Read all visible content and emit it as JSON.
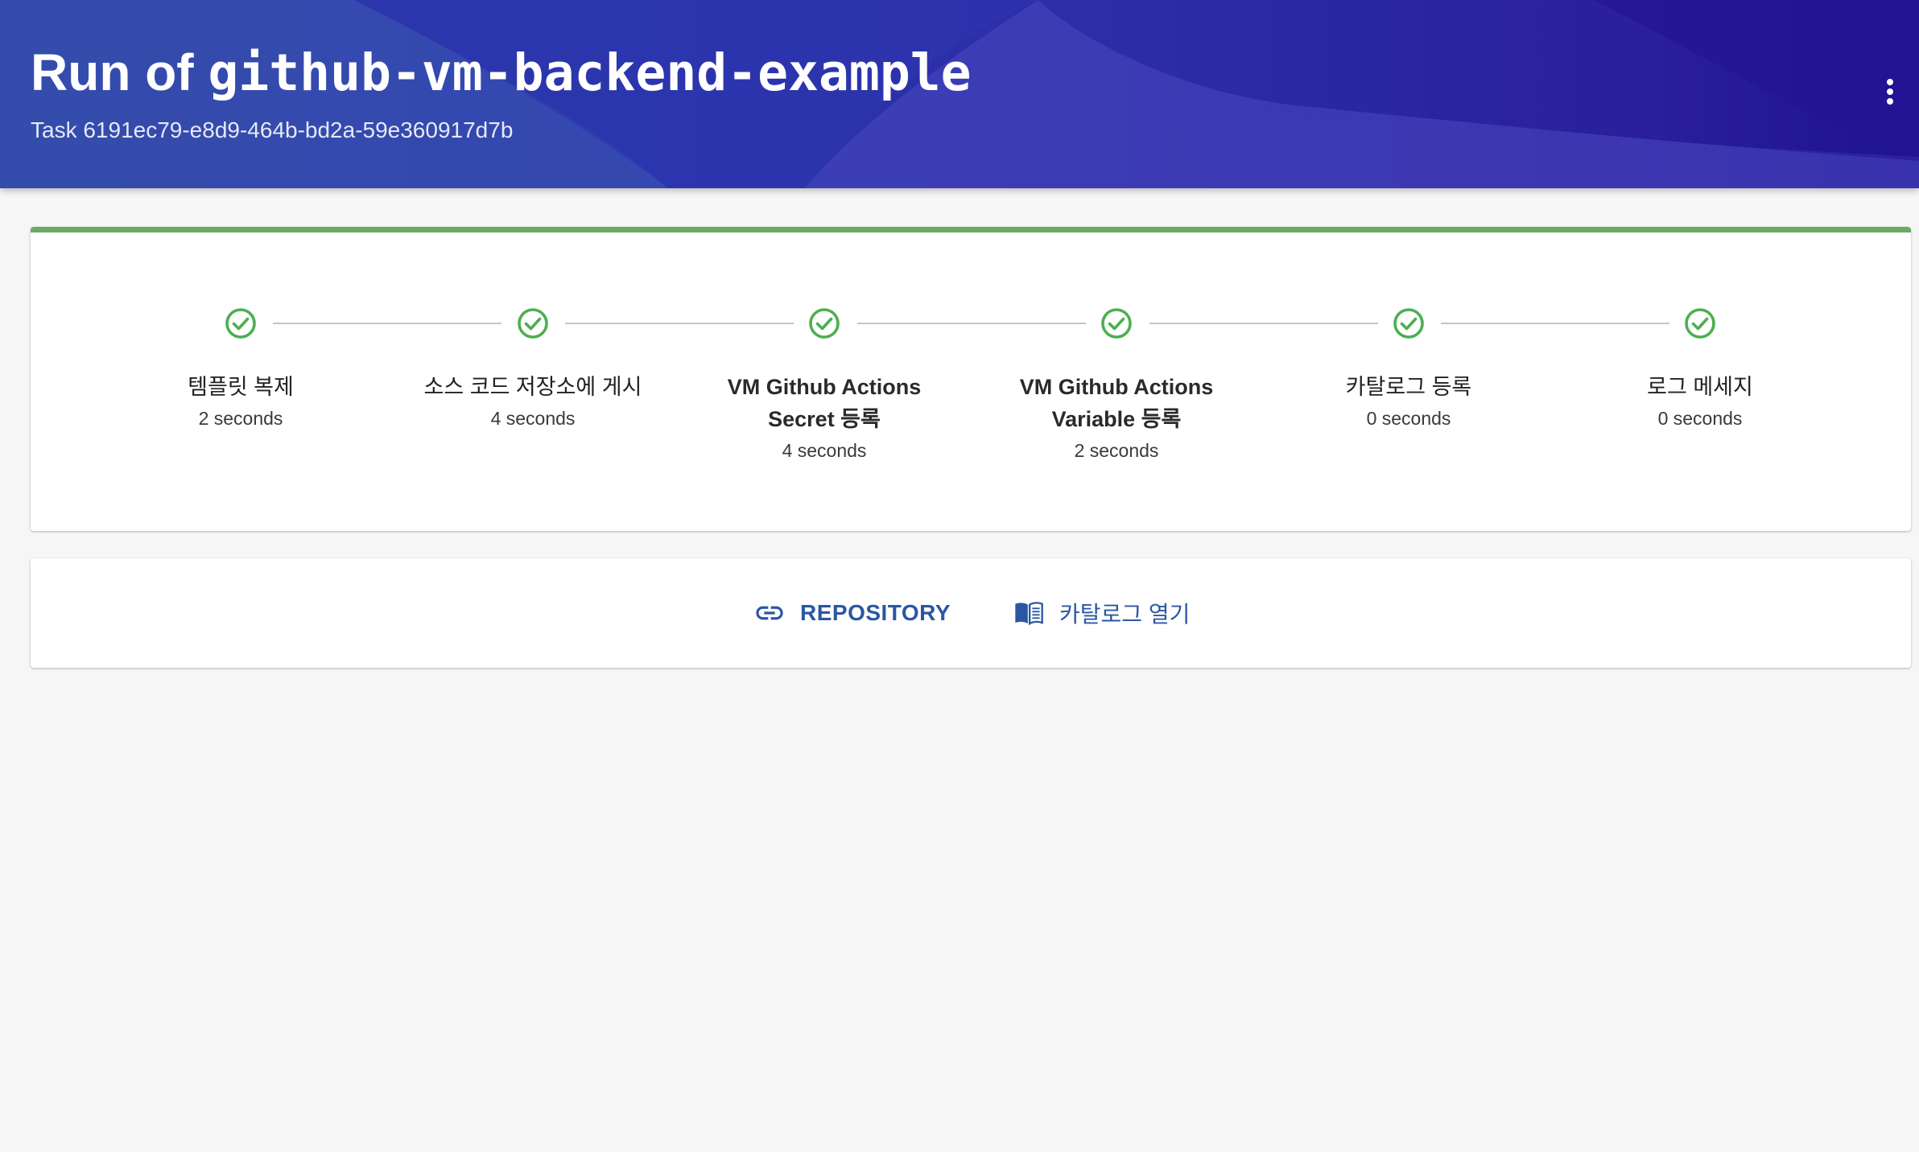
{
  "header": {
    "title_prefix": "Run of ",
    "title_template": "github-vm-backend-example",
    "subtitle": "Task 6191ec79-e8d9-464b-bd2a-59e360917d7b",
    "menu_icon": "more-vert-icon"
  },
  "steps": [
    {
      "label": "템플릿 복제",
      "duration": "2 seconds",
      "status": "completed"
    },
    {
      "label": "소스 코드 저장소에 게시",
      "duration": "4 seconds",
      "status": "completed"
    },
    {
      "label_line1": "VM Github Actions",
      "label_line2": "Secret 등록",
      "duration": "4 seconds",
      "status": "completed"
    },
    {
      "label_line1": "VM Github Actions",
      "label_line2": "Variable 등록",
      "duration": "2 seconds",
      "status": "completed"
    },
    {
      "label": "카탈로그 등록",
      "duration": "0 seconds",
      "status": "completed"
    },
    {
      "label": "로그 메세지",
      "duration": "0 seconds",
      "status": "completed"
    }
  ],
  "links": {
    "repository": {
      "label": "REPOSITORY",
      "icon": "link-icon"
    },
    "catalog": {
      "label": "카탈로그 열기",
      "icon": "book-icon"
    }
  },
  "colors": {
    "accent": "#2a57a3",
    "success": "#4caf50",
    "progress_bar": "#6aaa64",
    "header_start": "#2b3f9e",
    "header_end": "#1e1290"
  }
}
